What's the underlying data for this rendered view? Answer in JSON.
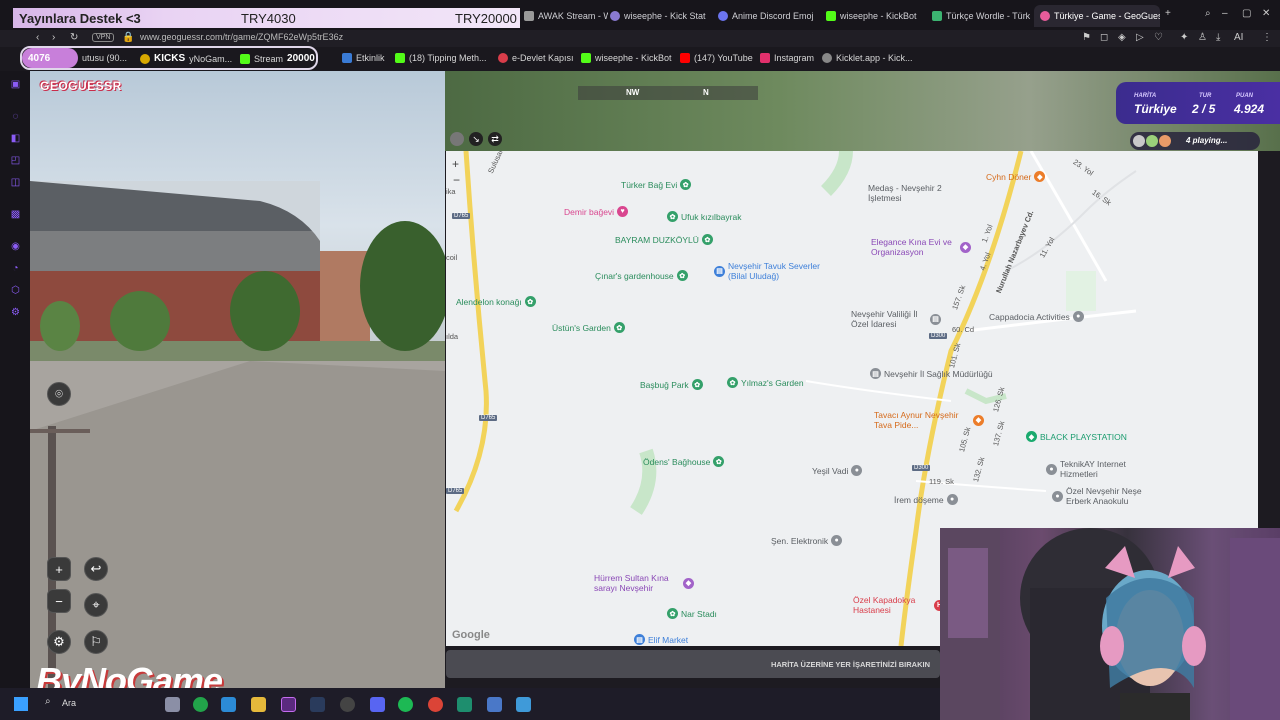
{
  "donation": {
    "label": "Yayınlara Destek <3",
    "current": "TRY4030",
    "goal": "TRY20000"
  },
  "tabs": [
    {
      "label": "AWAK Stream - Wa",
      "color": "#999999"
    },
    {
      "label": "wiseephe - Kick Stat",
      "color": "#8a7ad1"
    },
    {
      "label": "Anime Discord Emoj",
      "color": "#6b74ee"
    },
    {
      "label": "wiseephe - KickBot",
      "color": "#53fc18"
    },
    {
      "label": "Türkçe Wordle - Türk",
      "color": "#3cb371"
    },
    {
      "label": "Türkiye - Game - GeoGues",
      "color": "#e85c9a"
    }
  ],
  "address": {
    "vpn": "VPN",
    "url": "www.geoguessr.com/tr/game/ZQMF62eWp5trE36z"
  },
  "kicks": {
    "count": "4076",
    "label": "KICKS",
    "stream_count": "20000"
  },
  "bookmarks": [
    {
      "label": "utusu (90...",
      "color": "#888888"
    },
    {
      "label": "yNoGam...",
      "color": "#d8a800"
    },
    {
      "label": "Stream",
      "color": "#53fc18"
    },
    {
      "label": "Etkinlik",
      "color": "#3a7bd5"
    },
    {
      "label": "(18) Tipping Meth...",
      "color": "#53fc18"
    },
    {
      "label": "e-Devlet Kapısı",
      "color": "#d93d4a"
    },
    {
      "label": "wiseephe - KickBot",
      "color": "#53fc18"
    },
    {
      "label": "(147) YouTube",
      "color": "#ff0000"
    },
    {
      "label": "Instagram",
      "color": "#e1306c"
    },
    {
      "label": "Kicklet.app - Kick...",
      "color": "#888888"
    }
  ],
  "game": {
    "logo": "GEOGUESSR",
    "map_label": "HARİTA",
    "map_value": "Türkiye",
    "round_label": "TUR",
    "round_value": "2 / 5",
    "score_label": "PUAN",
    "score_value": "4.924",
    "players": "4 playing...",
    "compass": {
      "nw": "NW",
      "n": "N"
    },
    "guess_hint": "HARİTA ÜZERİNE YER İŞARETİNİZİ BIRAKIN"
  },
  "map": {
    "pois": [
      {
        "label": "Türker Bağ Evi",
        "type": "green"
      },
      {
        "label": "Demir bağevi",
        "type": "pink"
      },
      {
        "label": "Ufuk kızılbayrak",
        "type": "green"
      },
      {
        "label": "BAYRAM DUZKÖYLÜ",
        "type": "green"
      },
      {
        "label": "Çınar's gardenhouse",
        "type": "green"
      },
      {
        "label": "Nevşehir Tavuk Severler (Bilal Uludağ)",
        "type": "blue"
      },
      {
        "label": "Alendelon konağı",
        "type": "green"
      },
      {
        "label": "Üstün's Garden",
        "type": "green"
      },
      {
        "label": "Başbuğ Park",
        "type": "green"
      },
      {
        "label": "Yılmaz's Garden",
        "type": "green"
      },
      {
        "label": "Ödens' Bağhouse",
        "type": "green"
      },
      {
        "label": "Cyhn Döner",
        "type": "orange"
      },
      {
        "label": "Medaş - Nevşehir 2 İşletmesi",
        "type": "grey"
      },
      {
        "label": "Elegance Kına Evi ve Organizasyon",
        "type": "purple"
      },
      {
        "label": "Nevşehir Valiliği İl Özel İdaresi",
        "type": "grey"
      },
      {
        "label": "Cappadocia Activities",
        "type": "grey"
      },
      {
        "label": "Nevşehir İl Sağlık Müdürlüğü",
        "type": "grey"
      },
      {
        "label": "Tavacı Aynur Nevşehir Tava Pide...",
        "type": "orange"
      },
      {
        "label": "BLACK PLAYSTATION",
        "type": "teal"
      },
      {
        "label": "Yeşil Vadi",
        "type": "grey"
      },
      {
        "label": "TeknikAY Internet Hizmetleri",
        "type": "grey"
      },
      {
        "label": "İrem döşeme",
        "type": "grey"
      },
      {
        "label": "Özel Nevşehir Neşe Erberk Anaokulu",
        "type": "grey"
      },
      {
        "label": "Şen. Elektronik",
        "type": "grey"
      },
      {
        "label": "Hürrem Sultan Kına sarayı Nevşehir",
        "type": "purple"
      },
      {
        "label": "Nar Stadı",
        "type": "green"
      },
      {
        "label": "Özel Kapadokya Hastanesi",
        "type": "red"
      },
      {
        "label": "Elif Market",
        "type": "blue"
      }
    ],
    "streets": [
      "Sulusaray Yolu",
      "Nurullah Nazarbayev Cd.",
      "23. Yol",
      "16. Sk",
      "1. Yol",
      "4. Yol",
      "11. Yol",
      "157. Sk",
      "60. Cd",
      "101. Sk",
      "126. Sk",
      "137. Sk",
      "105. Sk",
      "119. Sk",
      "132. Sk",
      "ılda",
      "coil",
      "ika"
    ],
    "roads": [
      "D765",
      "D765",
      "D765",
      "D300",
      "D300"
    ],
    "attribution": "Google"
  },
  "brand": "ByNoGame",
  "taskbar": {
    "search": "Ara"
  }
}
